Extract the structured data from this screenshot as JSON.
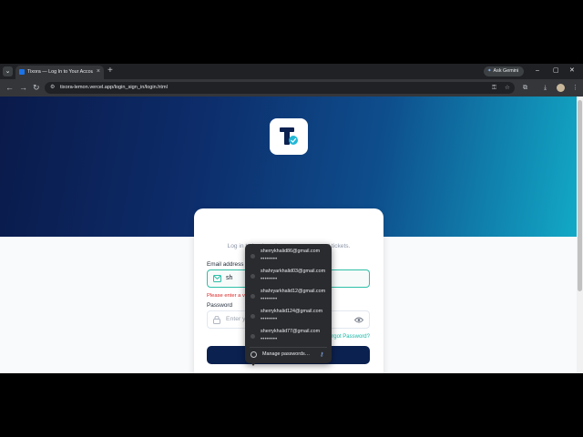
{
  "browser": {
    "tab_title": "Tixora — Log In to Your Account",
    "tab_close": "×",
    "new_tab": "+",
    "tab_dropdown": "⌄",
    "gemini_label": "Ask Gemini",
    "url": "tixora-lemon.vercel.app/login_sign_in/login.html",
    "icons": [
      "back-icon",
      "forward-icon",
      "reload-icon",
      "site-info-icon",
      "password-key-icon",
      "bookmark-star-icon",
      "extensions-icon",
      "download-icon",
      "menu-icon"
    ]
  },
  "login": {
    "subtitle": "Log in to book and manage your event tickets.",
    "email_label": "Email address",
    "email_value": "sh",
    "email_error": "Please enter a valid email address.",
    "password_label": "Password",
    "password_placeholder": "Enter your password",
    "forgot_label": "Forgot Password?",
    "login_button": "Log In"
  },
  "autofill": {
    "items": [
      {
        "email": "sherrykhalid86@gmail.com",
        "masked": "••••••••"
      },
      {
        "email": "shahryarkhalid03@gmail.com",
        "masked": "••••••••"
      },
      {
        "email": "shahryarkhalid12@gmail.com",
        "masked": "••••••••"
      },
      {
        "email": "sherrykhalid124@gmail.com",
        "masked": "••••••••"
      },
      {
        "email": "sherrykhalid77@gmail.com",
        "masked": "••••••••"
      }
    ],
    "manage_label": "Manage passwords…"
  },
  "colors": {
    "hero_start": "#0a1a4a",
    "hero_end": "#12a9c6",
    "button_bg": "#0b2150",
    "accent": "#14b8a6",
    "error": "#dc2626"
  }
}
